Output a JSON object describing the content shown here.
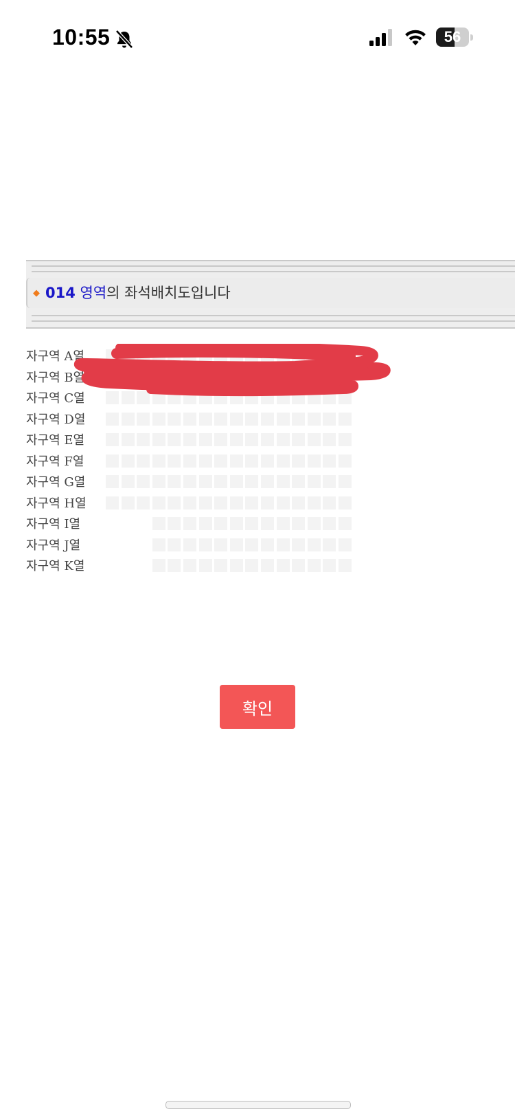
{
  "status_bar": {
    "time": "10:55",
    "battery": "56",
    "battery_level": 0.56,
    "icons": [
      "bell-slash-icon",
      "cellular-signal-icon",
      "wifi-icon",
      "battery-icon"
    ]
  },
  "header": {
    "marker": "◆",
    "zone_number": "014",
    "zone_word": "영역",
    "suffix": "의 좌석배치도입니다"
  },
  "seat_rows": [
    {
      "label": "자구역 A열",
      "seats": 16,
      "offset": 0
    },
    {
      "label": "자구역 B열",
      "seats": 16,
      "offset": 0
    },
    {
      "label": "자구역 C열",
      "seats": 16,
      "offset": 0
    },
    {
      "label": "자구역 D열",
      "seats": 16,
      "offset": 0
    },
    {
      "label": "자구역 E열",
      "seats": 16,
      "offset": 0
    },
    {
      "label": "자구역 F열",
      "seats": 16,
      "offset": 0
    },
    {
      "label": "자구역 G열",
      "seats": 16,
      "offset": 0
    },
    {
      "label": "자구역 H열",
      "seats": 16,
      "offset": 0
    },
    {
      "label": "자구역 I열",
      "seats": 13,
      "offset": 3
    },
    {
      "label": "자구역 J열",
      "seats": 13,
      "offset": 3
    },
    {
      "label": "자구역 K열",
      "seats": 13,
      "offset": 3
    }
  ],
  "confirm_label": "확인",
  "colors": {
    "accent_red": "#f35656",
    "zone_blue": "#1a17c8",
    "marker_orange": "#f07c1c",
    "scribble_red": "#e23c48",
    "seat_fill": "#f3f3f3"
  }
}
